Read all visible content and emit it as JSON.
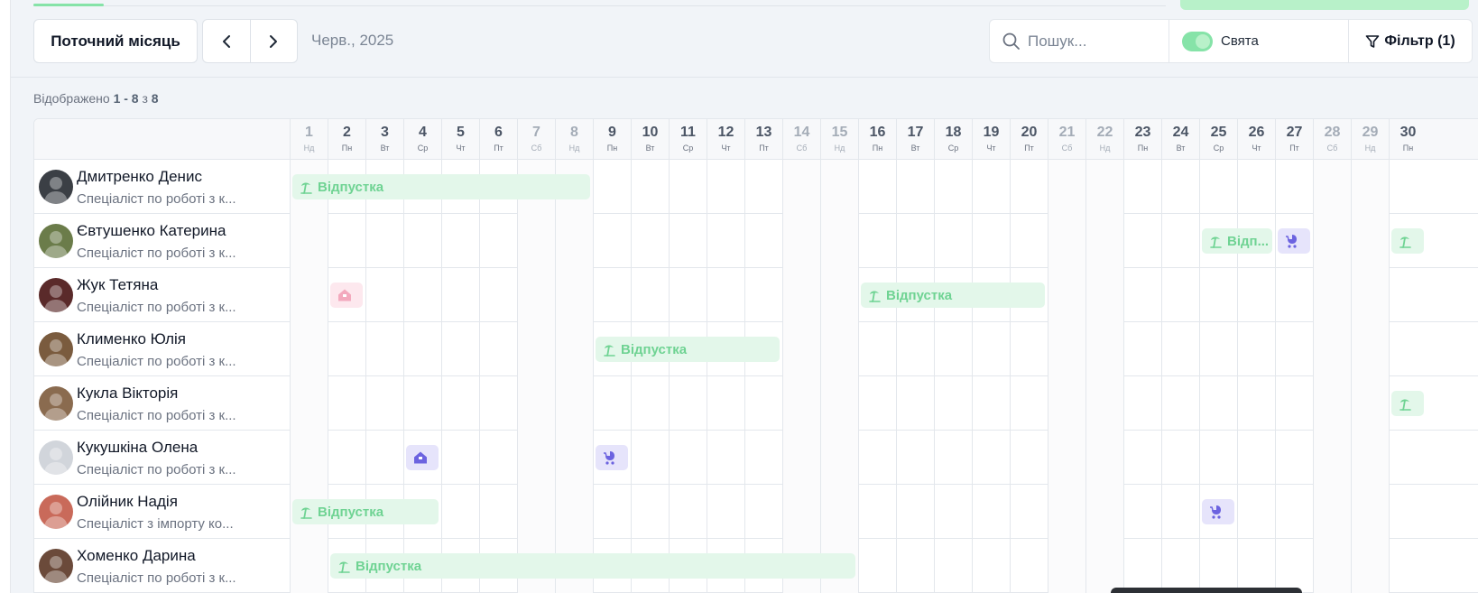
{
  "toolbar": {
    "current_month_label": "Поточний місяць",
    "period_label": "Черв., 2025",
    "search_placeholder": "Пошук...",
    "holidays_label": "Свята",
    "filter_label": "Фільтр (1)"
  },
  "summary": {
    "prefix": "Відображено",
    "range": "1 - 8",
    "of": "з",
    "total": "8"
  },
  "colors": {
    "vacation": "#6fd393",
    "vacation_bg": "#e3f7ea",
    "child": "#6c63e0",
    "child_bg": "#e6e4fb",
    "remote_pink": "#f3a9bd",
    "remote_pink_bg": "#fde8ee"
  },
  "days": [
    {
      "d": "1",
      "w": "Нд",
      "we": true
    },
    {
      "d": "2",
      "w": "Пн",
      "we": false
    },
    {
      "d": "3",
      "w": "Вт",
      "we": false
    },
    {
      "d": "4",
      "w": "Ср",
      "we": false
    },
    {
      "d": "5",
      "w": "Чт",
      "we": false
    },
    {
      "d": "6",
      "w": "Пт",
      "we": false
    },
    {
      "d": "7",
      "w": "Сб",
      "we": true
    },
    {
      "d": "8",
      "w": "Нд",
      "we": true
    },
    {
      "d": "9",
      "w": "Пн",
      "we": false
    },
    {
      "d": "10",
      "w": "Вт",
      "we": false
    },
    {
      "d": "11",
      "w": "Ср",
      "we": false
    },
    {
      "d": "12",
      "w": "Чт",
      "we": false
    },
    {
      "d": "13",
      "w": "Пт",
      "we": false
    },
    {
      "d": "14",
      "w": "Сб",
      "we": true
    },
    {
      "d": "15",
      "w": "Нд",
      "we": true
    },
    {
      "d": "16",
      "w": "Пн",
      "we": false
    },
    {
      "d": "17",
      "w": "Вт",
      "we": false
    },
    {
      "d": "18",
      "w": "Ср",
      "we": false
    },
    {
      "d": "19",
      "w": "Чт",
      "we": false
    },
    {
      "d": "20",
      "w": "Пт",
      "we": false
    },
    {
      "d": "21",
      "w": "Сб",
      "we": true
    },
    {
      "d": "22",
      "w": "Нд",
      "we": true
    },
    {
      "d": "23",
      "w": "Пн",
      "we": false
    },
    {
      "d": "24",
      "w": "Вт",
      "we": false
    },
    {
      "d": "25",
      "w": "Ср",
      "we": false
    },
    {
      "d": "26",
      "w": "Чт",
      "we": false
    },
    {
      "d": "27",
      "w": "Пт",
      "we": false
    },
    {
      "d": "28",
      "w": "Сб",
      "we": true
    },
    {
      "d": "29",
      "w": "Нд",
      "we": true
    },
    {
      "d": "30",
      "w": "Пн",
      "we": false
    }
  ],
  "employees": [
    {
      "name": "Дмитренко Денис",
      "role": "Спеціаліст по роботі з к...",
      "avatar_color": "#3b3f45",
      "absences": [
        {
          "type": "vacation",
          "start": 1,
          "end": 8,
          "label": "Відпустка"
        }
      ]
    },
    {
      "name": "Євтушенко Катерина",
      "role": "Спеціаліст по роботі з к...",
      "avatar_color": "#6b7c4a",
      "absences": [
        {
          "type": "vacation",
          "start": 25,
          "end": 26,
          "label": "Відп..."
        },
        {
          "type": "child",
          "start": 27,
          "end": 27
        },
        {
          "type": "vacation",
          "start": 30,
          "end": 30
        }
      ]
    },
    {
      "name": "Жук Тетяна",
      "role": "Спеціаліст по роботі з к...",
      "avatar_color": "#5a2a2a",
      "absences": [
        {
          "type": "remote_pink",
          "start": 2,
          "end": 2
        },
        {
          "type": "vacation",
          "start": 16,
          "end": 20,
          "label": "Відпустка"
        }
      ]
    },
    {
      "name": "Клименко Юлія",
      "role": "Спеціаліст по роботі з к...",
      "avatar_color": "#7a5b3e",
      "absences": [
        {
          "type": "vacation",
          "start": 9,
          "end": 13,
          "label": "Відпустка"
        }
      ]
    },
    {
      "name": "Кукла Вікторія",
      "role": "Спеціаліст по роботі з к...",
      "avatar_color": "#8a6b4f",
      "absences": [
        {
          "type": "vacation",
          "start": 30,
          "end": 30
        }
      ]
    },
    {
      "name": "Кукушкіна Олена",
      "role": "Спеціаліст по роботі з к...",
      "avatar_color": "#d1d5db",
      "absences": [
        {
          "type": "remote_purple",
          "start": 4,
          "end": 4
        },
        {
          "type": "child",
          "start": 9,
          "end": 9
        }
      ]
    },
    {
      "name": "Олійник Надія",
      "role": "Спеціаліст з імпорту ко...",
      "avatar_color": "#c96a5a",
      "absences": [
        {
          "type": "vacation",
          "start": 1,
          "end": 4,
          "label": "Відпустка"
        },
        {
          "type": "child",
          "start": 25,
          "end": 25
        }
      ]
    },
    {
      "name": "Хоменко Дарина",
      "role": "Спеціаліст по роботі з к...",
      "avatar_color": "#6b4a3a",
      "absences": [
        {
          "type": "vacation",
          "start": 2,
          "end": 15,
          "label": "Відпустка"
        }
      ]
    }
  ]
}
